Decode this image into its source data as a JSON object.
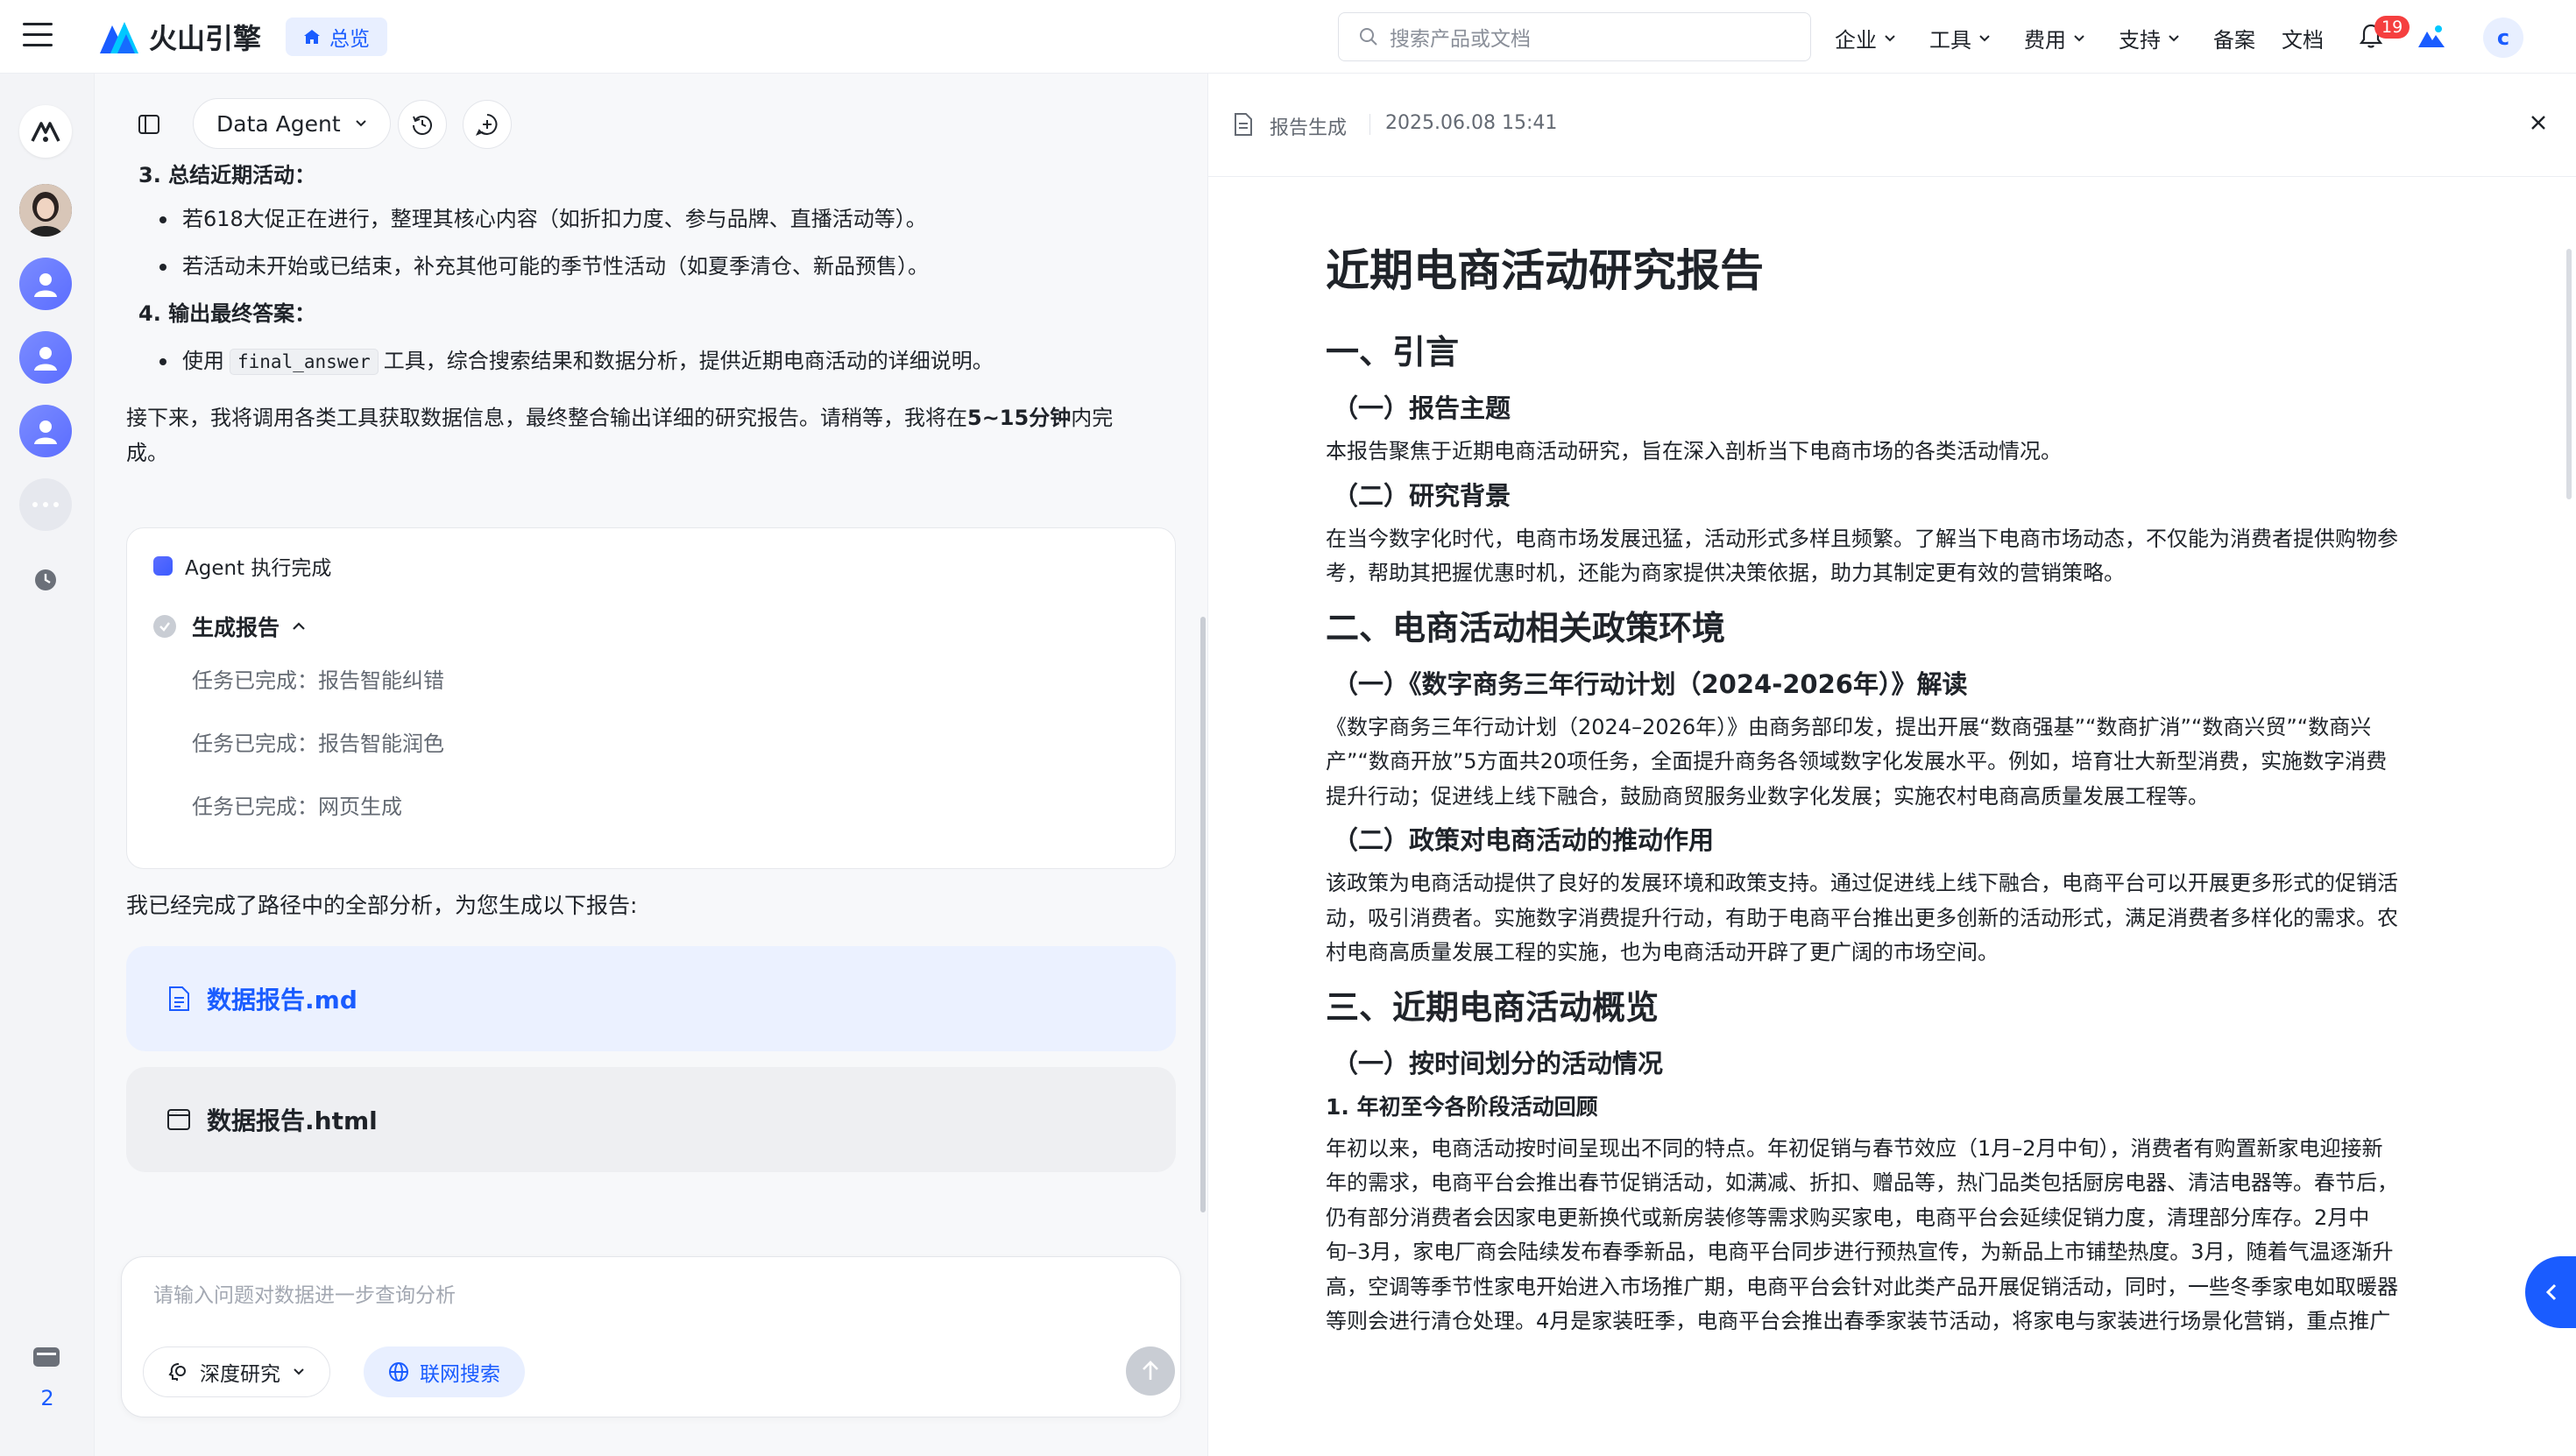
{
  "topbar": {
    "brand": "火山引擎",
    "overview": "总览",
    "search_placeholder": "搜索产品或文档",
    "nav": [
      {
        "label": "企业"
      },
      {
        "label": "工具"
      },
      {
        "label": "费用"
      },
      {
        "label": "支持"
      },
      {
        "label": "备案"
      },
      {
        "label": "文档"
      }
    ],
    "notification_count": "19",
    "avatar_letter": "c"
  },
  "rail": {
    "icons": [
      "agent-logo-icon",
      "user-avatar",
      "user-icon",
      "user-icon",
      "user-icon",
      "more-icon",
      "clock-icon"
    ],
    "bottom_icon": "tray-icon",
    "count": "2"
  },
  "chat": {
    "agent_name": "Data Agent",
    "steps": [
      {
        "title": "3. 总结近期活动：",
        "bullets": [
          "若618大促正在进行，整理其核心内容（如折扣力度、参与品牌、直播活动等）。",
          "若活动未开始或已结束，补充其他可能的季节性活动（如夏季清仓、新品预售）。"
        ]
      },
      {
        "title": "4. 输出最终答案：",
        "bullet_prefix": "使用",
        "bullet_code": "final_answer",
        "bullet_suffix": "工具，综合搜索结果和数据分析，提供近期电商活动的详细说明。"
      }
    ],
    "intro_pre": "接下来，我将调用各类工具获取数据信息，最终整合输出详细的研究报告。请稍等，我将在",
    "intro_bold": "5~15分钟",
    "intro_post": "内完",
    "intro_line2": "成。",
    "status": "Agent 执行完成",
    "generate_label": "生成报告",
    "tasks": [
      "任务已完成：报告智能纠错",
      "任务已完成：报告智能润色",
      "任务已完成：网页生成"
    ],
    "done_msg": "我已经完成了路径中的全部分析，为您生成以下报告:",
    "files": [
      {
        "name": "数据报告.md"
      },
      {
        "name": "数据报告.html"
      }
    ],
    "input_placeholder": "请输入问题对数据进一步查询分析",
    "mode_deep": "深度研究",
    "mode_web": "联网搜索"
  },
  "report": {
    "header_label": "报告生成",
    "timestamp": "2025.06.08 15:41",
    "title": "近期电商活动研究报告",
    "s1": "一、引言",
    "s1_1": "（一）报告主题",
    "s1_1_p": "本报告聚焦于近期电商活动研究，旨在深入剖析当下电商市场的各类活动情况。",
    "s1_2": "（二）研究背景",
    "s1_2_p1": "在当今数字化时代，电商市场发展迅猛，活动形式多样且频繁。了解当下电商市场动态，不仅能为消费者提供购物参",
    "s1_2_p2": "考，帮助其把握优惠时机，还能为商家提供决策依据，助力其制定更有效的营销策略。",
    "s2": "二、电商活动相关政策环境",
    "s2_1": "（一）《数字商务三年行动计划（2024-2026年）》解读",
    "s2_1_p1": "《数字商务三年行动计划（2024–2026年）》由商务部印发，提出开展“数商强基”“数商扩消”“数商兴贸”“数商兴",
    "s2_1_p2": "产”“数商开放”5方面共20项任务，全面提升商务各领域数字化发展水平。例如，培育壮大新型消费，实施数字消费",
    "s2_1_p3": "提升行动；促进线上线下融合，鼓励商贸服务业数字化发展；实施农村电商高质量发展工程等。",
    "s2_2": "（二）政策对电商活动的推动作用",
    "s2_2_p1": "该政策为电商活动提供了良好的发展环境和政策支持。通过促进线上线下融合，电商平台可以开展更多形式的促销活",
    "s2_2_p2": "动，吸引消费者。实施数字消费提升行动，有助于电商平台推出更多创新的活动形式，满足消费者多样化的需求。农",
    "s2_2_p3": "村电商高质量发展工程的实施，也为电商活动开辟了更广阔的市场空间。",
    "s3": "三、近期电商活动概览",
    "s3_1": "（一）按时间划分的活动情况",
    "s3_1_1": "1. 年初至今各阶段活动回顾",
    "s3_1_p1": "年初以来，电商活动按时间呈现出不同的特点。年初促销与春节效应（1月–2月中旬），消费者有购置新家电迎接新",
    "s3_1_p2": "年的需求，电商平台会推出春节促销活动，如满减、折扣、赠品等，热门品类包括厨房电器、清洁电器等。春节后，",
    "s3_1_p3": "仍有部分消费者会因家电更新换代或新房装修等需求购买家电，电商平台会延续促销力度，清理部分库存。2月中",
    "s3_1_p4": "旬–3月，家电厂商会陆续发布春季新品，电商平台同步进行预热宣传，为新品上市铺垫热度。3月，随着气温逐渐升",
    "s3_1_p5": "高，空调等季节性家电开始进入市场推广期，电商平台会针对此类产品开展促销活动，同时，一些冬季家电如取暖器",
    "s3_1_p6": "等则会进行清仓处理。4月是家装旺季，电商平台会推出春季家装节活动，将家电与家装进行场景化营销，重点推广"
  }
}
